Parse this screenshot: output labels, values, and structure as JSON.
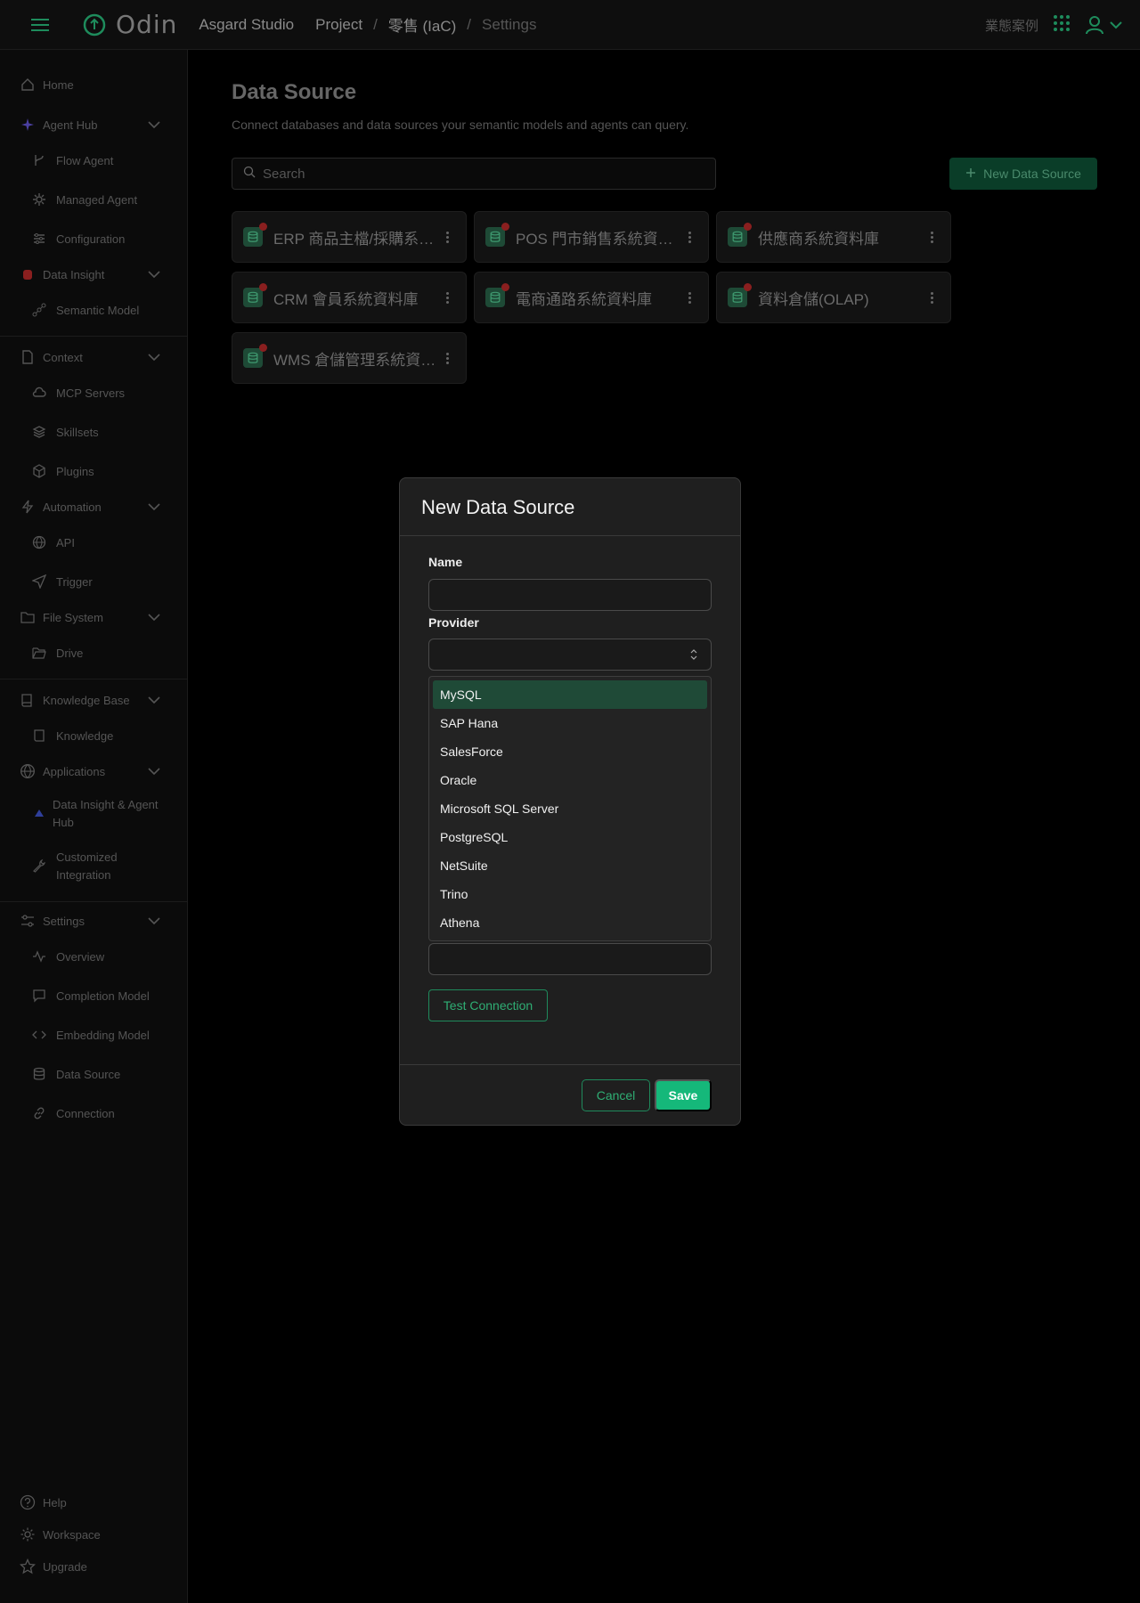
{
  "topbar": {
    "brand": "Odin",
    "org": "Asgard Studio",
    "breadcrumb": [
      "Project",
      "零售 (IaC)",
      "Settings"
    ],
    "case_link": "業態案例"
  },
  "sidebar": {
    "home": "Home",
    "agent_hub": "Agent Hub",
    "flow_agent": "Flow Agent",
    "managed_agent": "Managed Agent",
    "configuration": "Configuration",
    "data_insight": "Data Insight",
    "semantic_model": "Semantic Model",
    "context": "Context",
    "mcp_servers": "MCP Servers",
    "skillsets": "Skillsets",
    "plugins": "Plugins",
    "automation": "Automation",
    "api": "API",
    "trigger": "Trigger",
    "file_system": "File System",
    "drive": "Drive",
    "knowledge_base": "Knowledge Base",
    "knowledge": "Knowledge",
    "applications": "Applications",
    "app_data_insight_1": "Data Insight & Agent",
    "app_data_insight_2": "Hub",
    "app_custom_1": "Customized",
    "app_custom_2": "Integration",
    "settings": "Settings",
    "overview": "Overview",
    "completion_model": "Completion Model",
    "embedding_model": "Embedding Model",
    "data_source": "Data Source",
    "connection": "Connection",
    "help": "Help",
    "workspace": "Workspace",
    "upgrade": "Upgrade"
  },
  "main": {
    "title": "Data Source",
    "subtitle": "Connect databases and data sources your semantic models and agents can query.",
    "search_placeholder": "Search",
    "new_button": "New Data Source",
    "cards": [
      {
        "name": "ERP 商品主檔/採購系統資料庫"
      },
      {
        "name": "POS 門市銷售系統資料庫"
      },
      {
        "name": "供應商系統資料庫"
      },
      {
        "name": "CRM 會員系統資料庫"
      },
      {
        "name": "電商通路系統資料庫"
      },
      {
        "name": "資料倉儲(OLAP)"
      },
      {
        "name": "WMS 倉儲管理系統資料庫"
      }
    ]
  },
  "modal": {
    "title": "New Data Source",
    "name_label": "Name",
    "name_value": "",
    "provider_label": "Provider",
    "provider_value": "",
    "options": [
      "MySQL",
      "SAP Hana",
      "SalesForce",
      "Oracle",
      "Microsoft SQL Server",
      "PostgreSQL",
      "NetSuite",
      "Trino",
      "Athena"
    ],
    "selected_option": "MySQL",
    "test_button": "Test Connection",
    "cancel_button": "Cancel",
    "save_button": "Save"
  },
  "colors": {
    "accent": "#15b87a",
    "background": "#000000",
    "modal_bg": "#1f1f1f",
    "selected_option_bg": "#1f4a37",
    "status_dot": "#8a1f1f"
  }
}
